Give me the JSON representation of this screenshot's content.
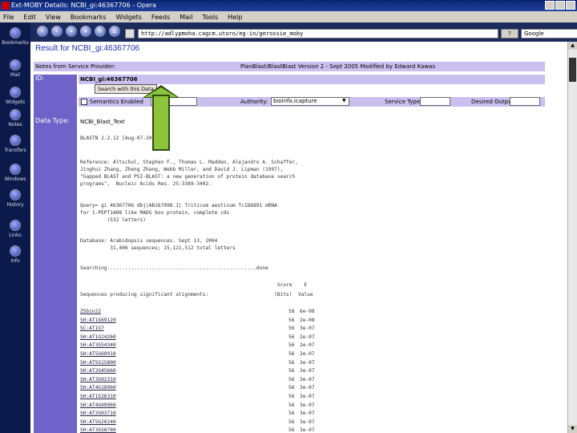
{
  "window": {
    "title": "Ext-MOBY Details: NCBI_gi:46367706 - Opera"
  },
  "menu": [
    "File",
    "Edit",
    "View",
    "Bookmarks",
    "Widgets",
    "Feeds",
    "Mail",
    "Tools",
    "Help"
  ],
  "sidebar": [
    {
      "label": "Bookmarks",
      "icon": "bookmarks-icon"
    },
    {
      "label": "Mail",
      "icon": "mail-icon"
    },
    {
      "label": "Widgets",
      "icon": "widgets-icon"
    },
    {
      "label": "Notes",
      "icon": "notes-icon"
    },
    {
      "label": "Transfers",
      "icon": "transfers-icon"
    },
    {
      "label": "Windows",
      "icon": "windows-icon"
    },
    {
      "label": "History",
      "icon": "history-icon"
    },
    {
      "label": "Links",
      "icon": "links-icon"
    },
    {
      "label": "Info",
      "icon": "info-icon"
    }
  ],
  "navbar": {
    "address": "http://adlypmoha.cagcm.utoro/eg-in/gerossie_moby",
    "go_label": "?",
    "search_placeholder": "Google"
  },
  "page": {
    "title": "Result for NCBI_gi:46367706",
    "notes_label": "Notes from Service Provider:",
    "notes_text": "PlanBlast/BlastBlast Version 2 - Sept 2005 Modified by Edward Kawas",
    "id_label": "ID:",
    "id_value": "NCBI_gi:46367706",
    "search_button": "Search with this Data",
    "checkbox_label": "Semantics Enabled",
    "authority_label": "Authority:",
    "authority_value": "bioinfo.icapture",
    "service_type_label": "Service Type:",
    "desired_output_label": "Desired Output:",
    "datatype_label": "Data Type:",
    "datatype_value": "NCBI_Blast_Text"
  },
  "blast": {
    "header": "BLASTN 2.2.12 [Aug-07-2005]",
    "reference": "Reference: Altschul, Stephen F., Thomas L. Madden, Alejandro A. Schaffer,\nJinghui Zhang, Zheng Zhang, Webb Miller, and David J. Lipman (1997),\n\"Gapped BLAST and PSI-BLAST: a new generation of protein database search\nprograms\",  Nucleic Acids Res. 25:3389-3402.",
    "query": "Query= gi 46367706 dbj|AB167998.1| Triticum aestivum Tc1D6891 mRNA\nfor 1-PEPT1A08 like MADS box protein, complete cds\n         (532 letters)",
    "database": "Database: Arabidopsis sequences. Sept 13, 2004\n          31,406 sequences; 15,121,512 total letters",
    "searching": "Searching..................................................done",
    "score_header": "                                                                  Score    E",
    "seq_header": "Sequences producing significant alignments:                      (Bits)  Value",
    "alignments": [
      {
        "name": "ZSbin22",
        "score": "58",
        "evalue": "6e-08"
      },
      {
        "name": "SH:AT1G69120",
        "score": "56",
        "evalue": "2e-08"
      },
      {
        "name": "SC:AT1G7",
        "score": "56",
        "evalue": "3e-07"
      },
      {
        "name": "SH:AT1G24260",
        "score": "56",
        "evalue": "2e-07"
      },
      {
        "name": "SH:AT3G54340",
        "score": "56",
        "evalue": "2e-07"
      },
      {
        "name": "SH:AT5G60910",
        "score": "56",
        "evalue": "2e-07"
      },
      {
        "name": "SH:AT5G15800",
        "score": "56",
        "evalue": "3e-07"
      },
      {
        "name": "SH:AT2G45660",
        "score": "56",
        "evalue": "3e-07"
      },
      {
        "name": "SH:AT3G02310",
        "score": "56",
        "evalue": "3e-07"
      },
      {
        "name": "SH:AT4G18960",
        "score": "56",
        "evalue": "3e-07"
      },
      {
        "name": "SH:AT1G26310",
        "score": "56",
        "evalue": "3e-07"
      },
      {
        "name": "SH:AT4G09960",
        "score": "56",
        "evalue": "3e-07"
      },
      {
        "name": "SH:AT2G03710",
        "score": "56",
        "evalue": "3e-07"
      },
      {
        "name": "SH:AT5G20240",
        "score": "56",
        "evalue": "3e-07"
      },
      {
        "name": "SH:AT3G58780",
        "score": "56",
        "evalue": "3e-07"
      }
    ]
  },
  "colors": {
    "label_bg": "#6f62c8",
    "bar_bg": "#c9c0ef",
    "arrow": "#8cc43c"
  }
}
